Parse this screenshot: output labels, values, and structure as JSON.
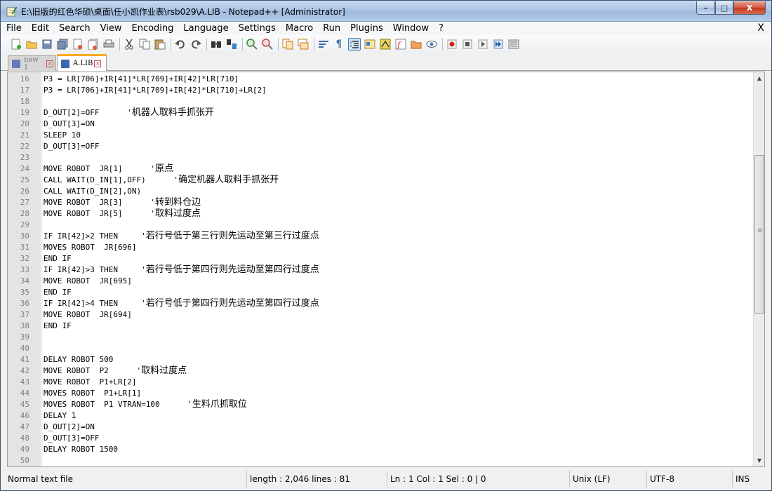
{
  "window": {
    "title": "E:\\旧版的红色华硕\\桌面\\任小凯作业表\\rsb029\\A.LIB - Notepad++ [Administrator]",
    "min_glyph": "–",
    "max_glyph": "□",
    "close_glyph": "X"
  },
  "menu": {
    "items": [
      "File",
      "Edit",
      "Search",
      "View",
      "Encoding",
      "Language",
      "Settings",
      "Macro",
      "Run",
      "Plugins",
      "Window",
      "?"
    ],
    "close_glyph": "X"
  },
  "toolbar": {
    "icons": [
      "new-file-icon",
      "open-file-icon",
      "save-icon",
      "save-all-icon",
      "close-icon",
      "close-all-icon",
      "print-icon",
      "cut-icon",
      "copy-icon",
      "paste-icon",
      "undo-icon",
      "redo-icon",
      "find-icon",
      "replace-icon",
      "zoom-in-icon",
      "zoom-out-icon",
      "sync-vertical-icon",
      "sync-horizontal-icon",
      "word-wrap-icon",
      "show-all-chars-icon",
      "indent-guide-icon",
      "user-language-icon",
      "document-map-icon",
      "function-list-icon",
      "folder-as-workspace-icon",
      "monitoring-icon",
      "record-macro-icon",
      "stop-macro-icon",
      "play-macro-icon",
      "run-macro-multiple-icon",
      "save-macro-icon"
    ],
    "active_icon": "indent-guide-icon"
  },
  "tabs": [
    {
      "label": "new 1",
      "active": false
    },
    {
      "label": "A.LIB",
      "active": true
    }
  ],
  "editor": {
    "lines": [
      {
        "n": "16",
        "code": "P3 = LR[706]+IR[41]*LR[709]+IR[42]*LR[710]",
        "comment": ""
      },
      {
        "n": "17",
        "code": "P3 = LR[706]+IR[41]*LR[709]+IR[42]*LR[710]+LR[2]",
        "comment": ""
      },
      {
        "n": "18",
        "code": "",
        "comment": ""
      },
      {
        "n": "19",
        "code": "D_OUT[2]=OFF      '",
        "comment": "机器人取料手抓张开"
      },
      {
        "n": "20",
        "code": "D_OUT[3]=ON",
        "comment": ""
      },
      {
        "n": "21",
        "code": "SLEEP 10",
        "comment": ""
      },
      {
        "n": "22",
        "code": "D_OUT[3]=OFF",
        "comment": ""
      },
      {
        "n": "23",
        "code": "",
        "comment": ""
      },
      {
        "n": "24",
        "code": "MOVE ROBOT  JR[1]      '",
        "comment": "原点"
      },
      {
        "n": "25",
        "code": "CALL WAIT(D_IN[1],OFF)      '",
        "comment": "确定机器人取料手抓张开"
      },
      {
        "n": "26",
        "code": "CALL WAIT(D_IN[2],ON)",
        "comment": ""
      },
      {
        "n": "27",
        "code": "MOVE ROBOT  JR[3]      '",
        "comment": "转到料仓边"
      },
      {
        "n": "28",
        "code": "MOVE ROBOT  JR[5]      '",
        "comment": "取料过度点"
      },
      {
        "n": "29",
        "code": "",
        "comment": ""
      },
      {
        "n": "30",
        "code": "IF IR[42]>2 THEN     '",
        "comment": "若行号低于第三行则先运动至第三行过度点"
      },
      {
        "n": "31",
        "code": "MOVES ROBOT  JR[696]",
        "comment": ""
      },
      {
        "n": "32",
        "code": "END IF",
        "comment": ""
      },
      {
        "n": "33",
        "code": "IF IR[42]>3 THEN     '",
        "comment": "若行号低于第四行则先运动至第四行过度点"
      },
      {
        "n": "34",
        "code": "MOVE ROBOT  JR[695]",
        "comment": ""
      },
      {
        "n": "35",
        "code": "END IF",
        "comment": ""
      },
      {
        "n": "36",
        "code": "IF IR[42]>4 THEN     '",
        "comment": "若行号低于第四行则先运动至第四行过度点"
      },
      {
        "n": "37",
        "code": "MOVE ROBOT  JR[694]",
        "comment": ""
      },
      {
        "n": "38",
        "code": "END IF",
        "comment": ""
      },
      {
        "n": "39",
        "code": "",
        "comment": ""
      },
      {
        "n": "40",
        "code": "",
        "comment": ""
      },
      {
        "n": "41",
        "code": "DELAY ROBOT 500",
        "comment": ""
      },
      {
        "n": "42",
        "code": "MOVE ROBOT  P2      '",
        "comment": "取料过度点"
      },
      {
        "n": "43",
        "code": "MOVE ROBOT  P1+LR[2]",
        "comment": ""
      },
      {
        "n": "44",
        "code": "MOVES ROBOT  P1+LR[1]",
        "comment": ""
      },
      {
        "n": "45",
        "code": "MOVES ROBOT  P1 VTRAN=100      '",
        "comment": "生料爪抓取位"
      },
      {
        "n": "46",
        "code": "DELAY 1",
        "comment": ""
      },
      {
        "n": "47",
        "code": "D_OUT[2]=ON",
        "comment": ""
      },
      {
        "n": "48",
        "code": "D_OUT[3]=OFF",
        "comment": ""
      },
      {
        "n": "49",
        "code": "DELAY ROBOT 1500",
        "comment": ""
      },
      {
        "n": "50",
        "code": "",
        "comment": ""
      }
    ]
  },
  "status": {
    "file_type": "Normal text file",
    "length": "length : 2,046    lines : 81",
    "position": "Ln : 1    Col : 1    Sel : 0 | 0",
    "eol": "Unix (LF)",
    "encoding": "UTF-8",
    "mode": "INS"
  },
  "colors": {
    "tab_active_accent": "#fbab21",
    "gutter_bg": "#e4e4e4",
    "line_number": "#808080"
  }
}
